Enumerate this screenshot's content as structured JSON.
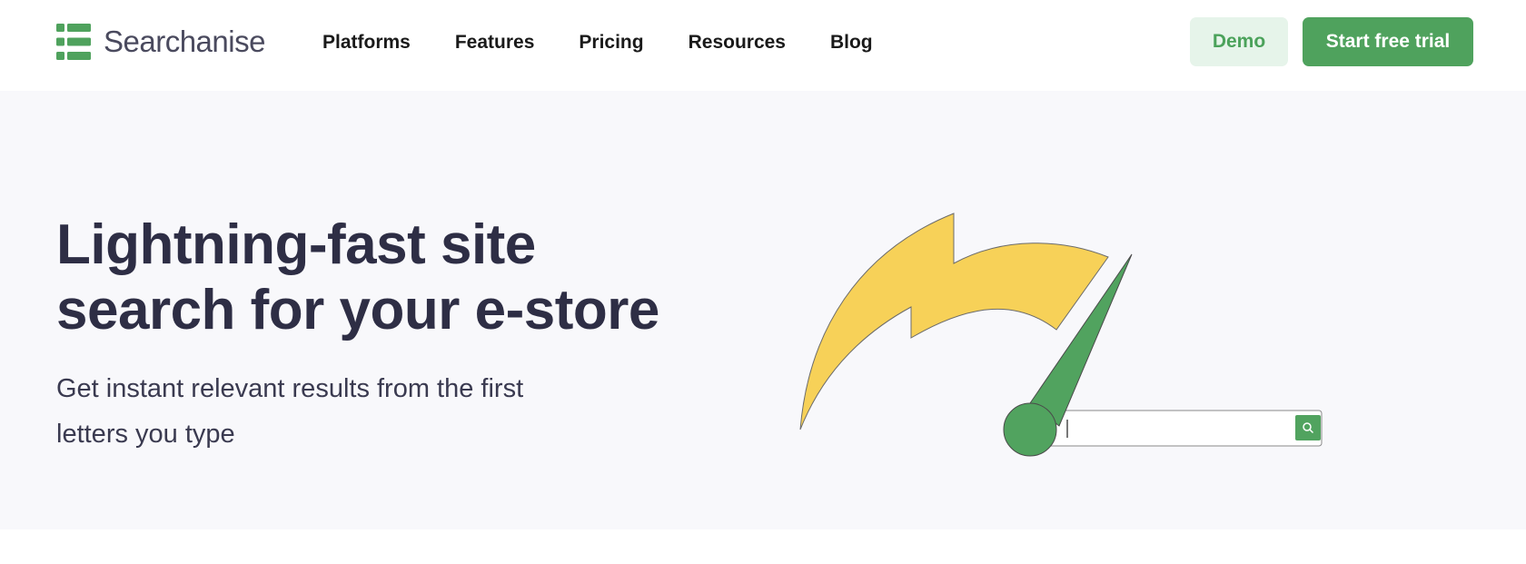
{
  "brand": {
    "name": "Searchanise",
    "logo_icon": "searchanise-logo-icon",
    "accent": "#4fa25d"
  },
  "nav": {
    "items": [
      {
        "label": "Platforms"
      },
      {
        "label": "Features"
      },
      {
        "label": "Pricing"
      },
      {
        "label": "Resources"
      },
      {
        "label": "Blog"
      }
    ]
  },
  "cta": {
    "demo_label": "Demo",
    "trial_label": "Start free trial"
  },
  "hero": {
    "title_line1": "Lightning-fast site",
    "title_line2": "search for your e-store",
    "subtitle_line1": "Get instant relevant results from the first",
    "subtitle_line2": "letters you type",
    "illustration": {
      "icons": [
        "lightning-bolt-icon",
        "speedometer-needle-icon",
        "search-icon"
      ],
      "colors": {
        "bolt": "#f7d158",
        "needle": "#51a35f",
        "search_button": "#51a35f"
      }
    }
  }
}
